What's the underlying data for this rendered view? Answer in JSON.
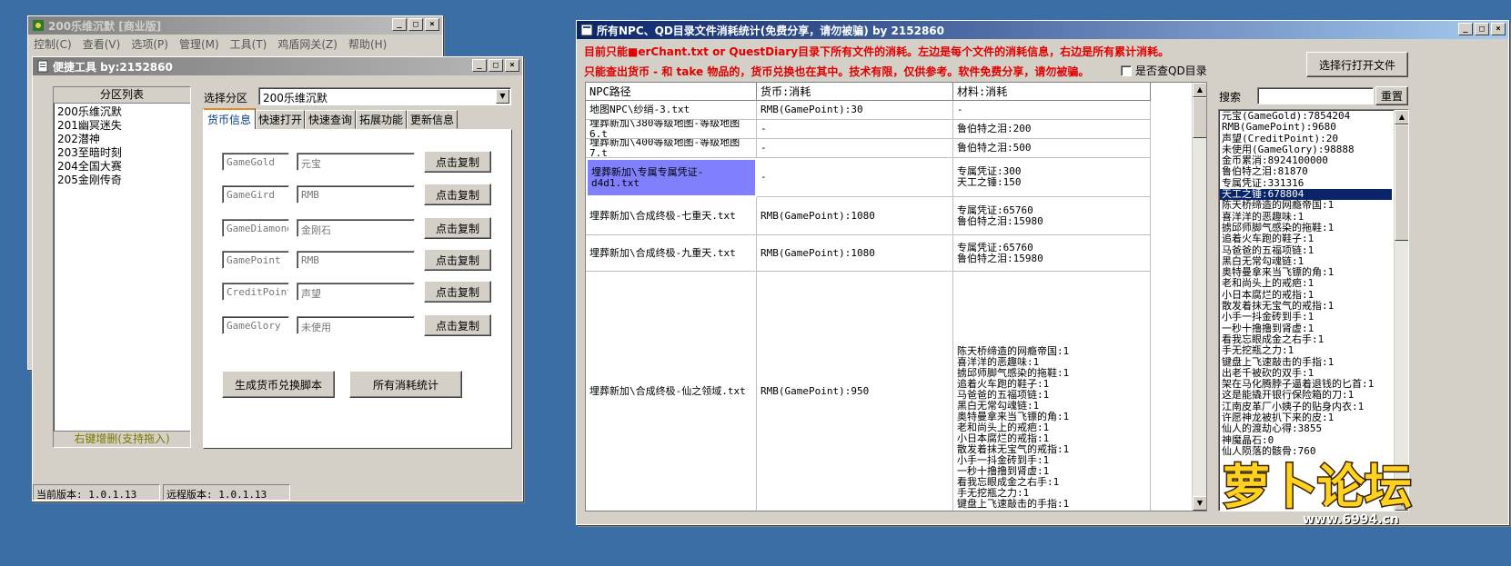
{
  "main_window": {
    "title": "200乐维沉默 [商业版]",
    "menu": [
      "控制(C)",
      "查看(V)",
      "选项(P)",
      "管理(M)",
      "工具(T)",
      "鸡盾网关(Z)",
      "帮助(H)"
    ]
  },
  "tools_window": {
    "title": "便捷工具   by:2152860",
    "partition_list_header": "分区列表",
    "partitions": [
      "200乐维沉默",
      "201幽冥迷失",
      "202潜神",
      "203至暗时刻",
      "204全国大赛",
      "205金刚传奇"
    ],
    "list_footer": "右键增删(支持拖入)",
    "select_label": "选择分区",
    "select_value": "200乐维沉默",
    "tabs": [
      "货币信息",
      "快速打开",
      "快速查询",
      "拓展功能",
      "更新信息"
    ],
    "currency_rows": [
      {
        "code": "GameGold",
        "name": "元宝",
        "button": "点击复制"
      },
      {
        "code": "GameGird",
        "name": "RMB",
        "button": "点击复制"
      },
      {
        "code": "GameDiamond",
        "name": "金刚石",
        "button": "点击复制"
      },
      {
        "code": "GamePoint",
        "name": "RMB",
        "button": "点击复制"
      },
      {
        "code": "CreditPoint",
        "name": "声望",
        "button": "点击复制"
      },
      {
        "code": "GameGlory",
        "name": "未使用",
        "button": "点击复制"
      }
    ],
    "gen_script_button": "生成货币兑换脚本",
    "all_stats_button": "所有消耗统计",
    "current_version": "当前版本: 1.0.1.13",
    "remote_version": "远程版本: 1.0.1.13"
  },
  "stats_window": {
    "title": "所有NPC、QD目录文件消耗统计(免费分享，请勿被骗)     by 2152860",
    "notice1": "目前只能■erChant.txt or QuestDiary目录下所有文件的消耗。左边是每个文件的消耗信息，右边是所有累计消耗。",
    "notice2": "只能查出货币 - 和 take 物品的，货币兑换也在其中。技术有限，仅供参考。软件免费分享，请勿被骗。",
    "qd_checkbox_label": "是否查QD目录",
    "open_file_button": "选择行打开文件",
    "search_label": "搜索",
    "search_value": "",
    "reset_button": "重置",
    "columns": [
      "NPC路径",
      "货币:消耗",
      "材料:消耗"
    ],
    "rows": [
      {
        "path": "地图NPC\\纱绡-3.txt",
        "currency": "RMB(GamePoint):30",
        "material": "-"
      },
      {
        "path": "埋葬新加\\380等级地图-等级地图6.t",
        "currency": "-",
        "material": "鲁伯特之泪:200"
      },
      {
        "path": "埋葬新加\\400等级地图-等级地图7.t",
        "currency": "-",
        "material": "鲁伯特之泪:500"
      },
      {
        "path": "埋葬新加\\专属专属凭证-d4d1.txt",
        "currency": "-",
        "material": "专属凭证:300\n天工之锤:150"
      },
      {
        "path": "埋葬新加\\合成终极-七重天.txt",
        "currency": "RMB(GamePoint):1080",
        "material": "专属凭证:65760\n鲁伯特之泪:15980"
      },
      {
        "path": "埋葬新加\\合成终极-九重天.txt",
        "currency": "RMB(GamePoint):1080",
        "material": "专属凭证:65760\n鲁伯特之泪:15980"
      },
      {
        "path": "埋葬新加\\合成终极-仙之领域.txt",
        "currency": "RMB(GamePoint):950",
        "material": "陈天桥缔造的网瘾帝国:1\n喜洋洋的恶趣味:1\n掳邱师脚气感染的拖鞋:1\n追着火车跑的鞋子:1\n马爸爸的五福项链:1\n黑白无常勾魂链:1\n奥特曼拿来当飞镖的角:1\n老和尚头上的戒疤:1\n小日本腐烂的戒指:1\n散发着抹无宝气的戒指:1\n小手一抖金砖到手:1\n一秒十撸撸到肾虚:1\n看我忘眼成金之右手:1\n手无挖瓶之力:1\n键盘上飞速敲击的手指:1"
      }
    ],
    "totals": [
      "元宝(GameGold):7854204",
      "RMB(GamePoint):9680",
      "声望(CreditPoint):20",
      "未使用(GameGlory):98888",
      "金币累消:8924100000",
      "鲁伯特之泪:81870",
      "专属凭证:331316",
      "天工之锤:678804",
      "陈天桥缔造的网瘾帝国:1",
      "喜洋洋的恶趣味:1",
      "掳邱师脚气感染的拖鞋:1",
      "追着火车跑的鞋子:1",
      "马爸爸的五福项链:1",
      "黑白无常勾魂链:1",
      "奥特曼拿来当飞镖的角:1",
      "老和尚头上的戒疤:1",
      "小日本腐烂的戒指:1",
      "散发着抹无宝气的戒指:1",
      "小手一抖金砖到手:1",
      "一秒十撸撸到肾虚:1",
      "看我忘眼成金之右手:1",
      "手无挖瓶之力:1",
      "键盘上飞速敲击的手指:1",
      "出老千被砍的双手:1",
      "架在马化腾脖子逼着退钱的匕首:1",
      "这是能撬开银行保险箱的刀:1",
      "江南皮革厂小姨子的贴身内衣:1",
      "许愿神龙被扒下来的皮:1",
      "仙人的渡劫心得:3855",
      "神魔晶石:0",
      "仙人陨落的骸骨:760"
    ],
    "selected_total_index": 7
  },
  "watermark": {
    "brand": "萝卜论坛",
    "url": "www.6994.cn"
  }
}
